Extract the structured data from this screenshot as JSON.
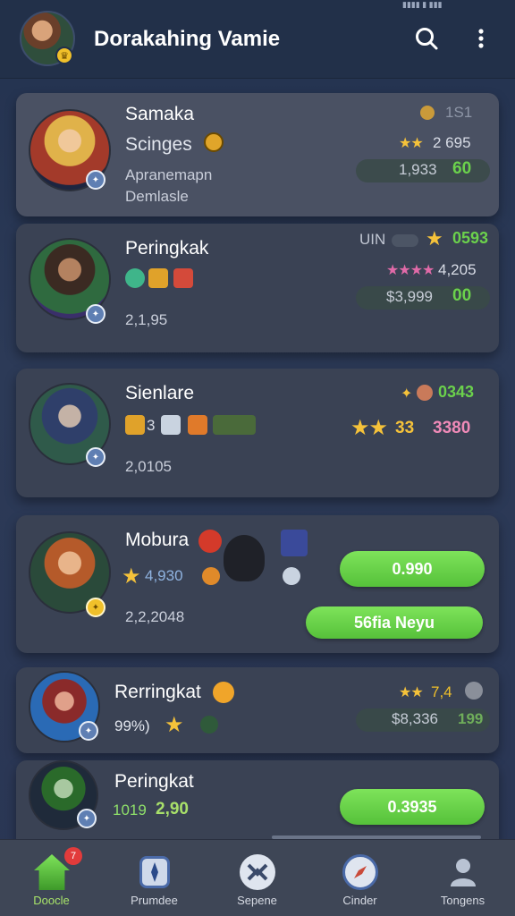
{
  "header": {
    "title": "Dorakahing Vamie",
    "status_text": "▮▮▮▮ ▮ ▮▮▮"
  },
  "cards": [
    {
      "name": "Samaka",
      "sub": "Scinges",
      "desc1": "Apranemapn",
      "desc2": "Demlasle",
      "rank_small": "1S1",
      "score": "2 695",
      "value_gray": "1,933",
      "value_green": "60"
    },
    {
      "name": "Peringkak",
      "sub_value": "2,1,95",
      "label_tag": "UIN",
      "rank_green": "0593",
      "score": "4,205",
      "value_gray": "$3,999",
      "value_green": "00"
    },
    {
      "name": "Sienlare",
      "items_count": "3",
      "sub_value": "2,0105",
      "rank_green": "0343",
      "stars_value": "33",
      "pink_value": "3380"
    },
    {
      "name": "Mobura",
      "rating": "4,930",
      "sub_value": "2,2,2048",
      "button1": "0.990",
      "button2": "56fia Neyu"
    },
    {
      "name": "Rerringkat",
      "percent": "99%)",
      "score": "7,4",
      "value_gray": "$8,336",
      "value_green": "199"
    },
    {
      "name": "Peringkat",
      "value_a": "1019",
      "value_b": "2,90",
      "button": "0.3935"
    }
  ],
  "nav": [
    {
      "label": "Doocle",
      "badge": "7",
      "active": true,
      "icon": "home-icon"
    },
    {
      "label": "Prumdee",
      "active": false,
      "icon": "card-icon"
    },
    {
      "label": "Sepene",
      "active": false,
      "icon": "shield-icon"
    },
    {
      "label": "Cinder",
      "active": false,
      "icon": "compass-icon"
    },
    {
      "label": "Tongens",
      "active": false,
      "icon": "profile-icon"
    }
  ],
  "colors": {
    "accent_green": "#6bd14c",
    "accent_pink": "#f08ab8",
    "star_gold": "#f5c23a",
    "background": "#2c3a57"
  }
}
